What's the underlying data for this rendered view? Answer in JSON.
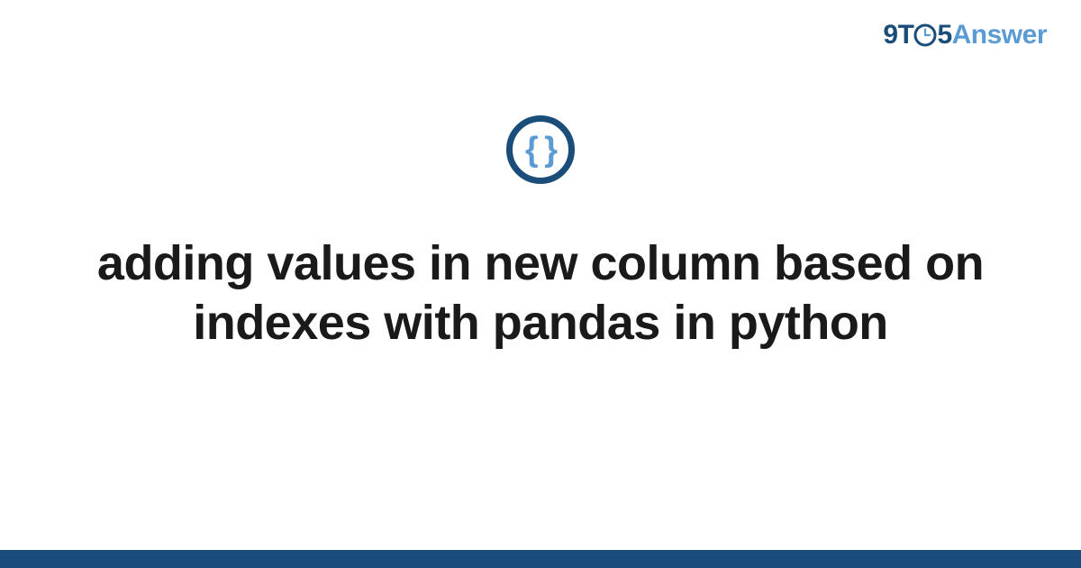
{
  "logo": {
    "part1": "9T",
    "part2": "5",
    "part3": "Answer"
  },
  "icon": {
    "name": "code-braces-icon",
    "glyph": "{ }"
  },
  "title": "adding values in new column based on indexes with pandas in python",
  "colors": {
    "brand_dark": "#1a4d7a",
    "brand_light": "#5a9bd4",
    "text": "#1a1a1a"
  }
}
